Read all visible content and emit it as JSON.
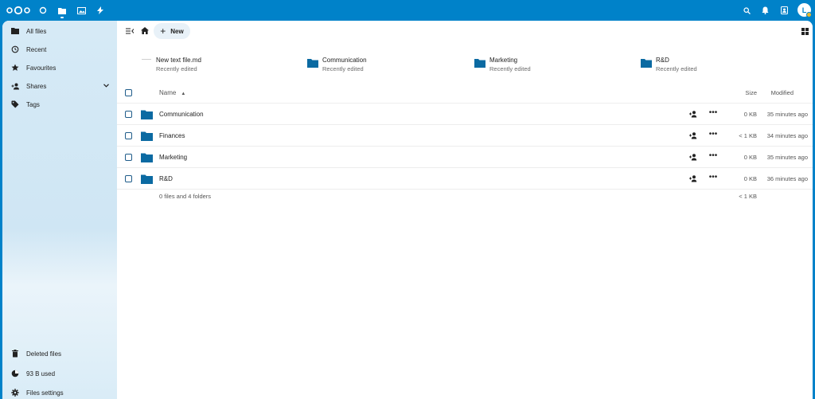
{
  "header": {
    "avatar_initial": "L"
  },
  "sidebar": {
    "items": [
      {
        "label": "All files",
        "icon": "folder-icon"
      },
      {
        "label": "Recent",
        "icon": "history-icon"
      },
      {
        "label": "Favourites",
        "icon": "star-icon"
      },
      {
        "label": "Shares",
        "icon": "account-plus-icon"
      },
      {
        "label": "Tags",
        "icon": "tag-icon"
      }
    ],
    "bottom": {
      "deleted": "Deleted files",
      "quota": "93 B used",
      "settings": "Files settings"
    }
  },
  "toolbar": {
    "new_label": "New"
  },
  "recent": [
    {
      "name": "New text file.md",
      "sub": "Recently edited",
      "type": "file"
    },
    {
      "name": "Communication",
      "sub": "Recently edited",
      "type": "folder"
    },
    {
      "name": "Marketing",
      "sub": "Recently edited",
      "type": "folder"
    },
    {
      "name": "R&D",
      "sub": "Recently edited",
      "type": "folder"
    }
  ],
  "table": {
    "headers": {
      "name": "Name",
      "size": "Size",
      "modified": "Modified"
    },
    "rows": [
      {
        "name": "Communication",
        "size": "0 KB",
        "modified": "35 minutes ago"
      },
      {
        "name": "Finances",
        "size": "< 1 KB",
        "modified": "34 minutes ago"
      },
      {
        "name": "Marketing",
        "size": "0 KB",
        "modified": "35 minutes ago"
      },
      {
        "name": "R&D",
        "size": "0 KB",
        "modified": "36 minutes ago"
      }
    ],
    "summary": "0 files and 4 folders",
    "summary_size": "< 1 KB"
  },
  "colors": {
    "brand": "#0082c9",
    "folder": "#0b6aa2"
  }
}
